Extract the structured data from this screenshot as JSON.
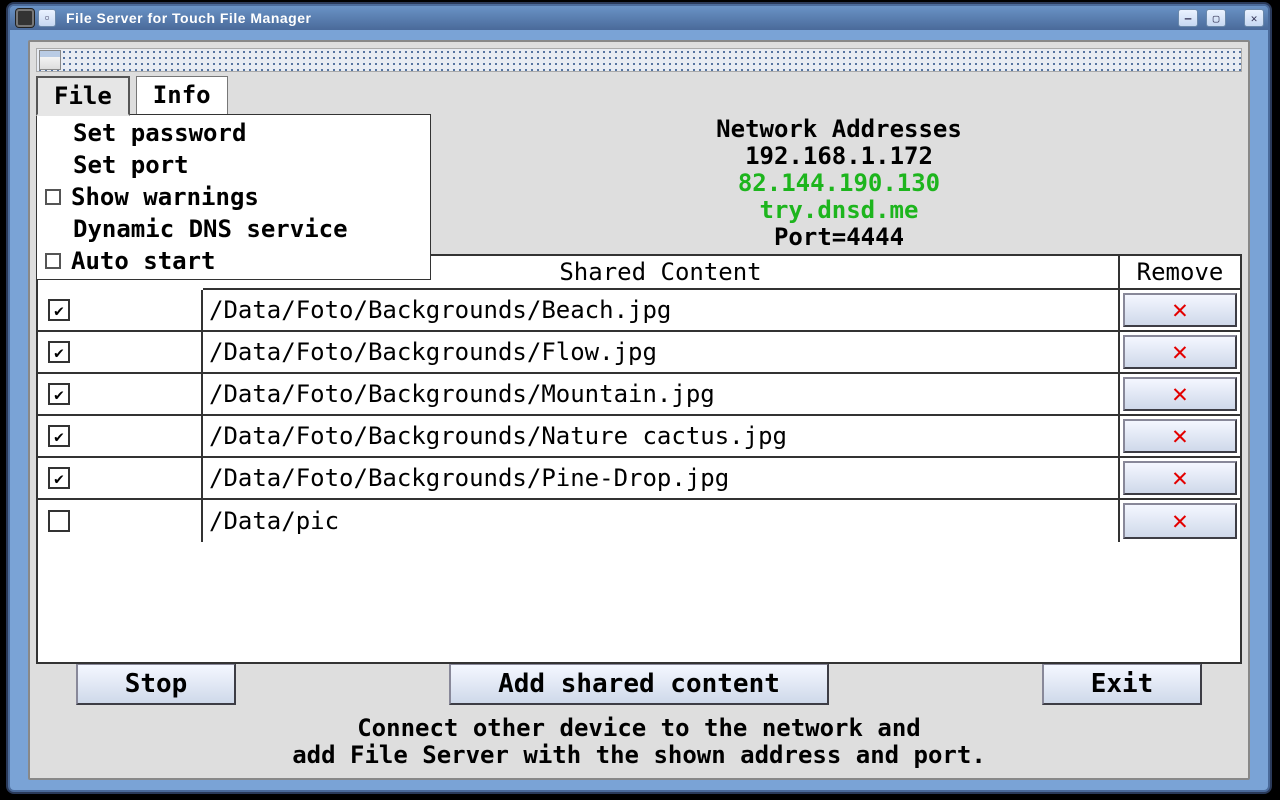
{
  "window": {
    "title": "File Server for Touch File Manager"
  },
  "menubar": {
    "items": [
      "File",
      "Info"
    ],
    "active_index": 0
  },
  "file_menu": {
    "items": [
      {
        "label": "Set password",
        "checkbox": false,
        "checked": false
      },
      {
        "label": "Set port",
        "checkbox": false,
        "checked": false
      },
      {
        "label": "Show warnings",
        "checkbox": true,
        "checked": false
      },
      {
        "label": "Dynamic DNS service",
        "checkbox": false,
        "checked": false
      },
      {
        "label": "Auto start",
        "checkbox": true,
        "checked": false
      }
    ]
  },
  "network": {
    "heading": "Network Addresses",
    "local_ip": "192.168.1.172",
    "public_ip": "82.144.190.130",
    "dns": "try.dnsd.me",
    "port_line": "Port=4444"
  },
  "table": {
    "header_shared": "Shared Content",
    "header_remove": "Remove",
    "rows": [
      {
        "checked": true,
        "path": "/Data/Foto/Backgrounds/Beach.jpg"
      },
      {
        "checked": true,
        "path": "/Data/Foto/Backgrounds/Flow.jpg"
      },
      {
        "checked": true,
        "path": "/Data/Foto/Backgrounds/Mountain.jpg"
      },
      {
        "checked": true,
        "path": "/Data/Foto/Backgrounds/Nature cactus.jpg"
      },
      {
        "checked": true,
        "path": "/Data/Foto/Backgrounds/Pine-Drop.jpg"
      },
      {
        "checked": false,
        "path": "/Data/pic"
      }
    ]
  },
  "buttons": {
    "stop": "Stop",
    "add": "Add shared content",
    "exit": "Exit"
  },
  "footer": {
    "line1": "Connect other device to the network and",
    "line2": "add File Server with the shown address and port."
  }
}
